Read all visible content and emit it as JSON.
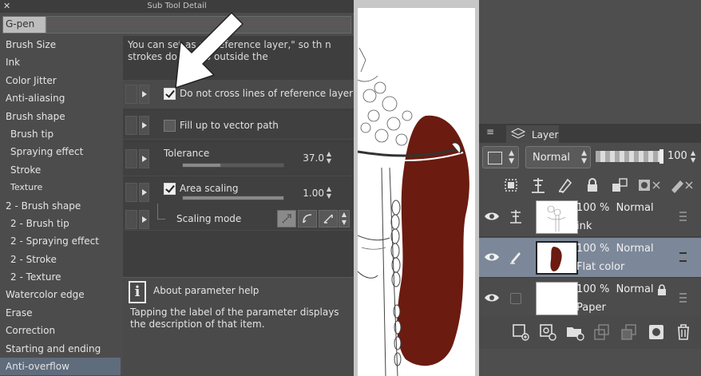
{
  "sub_tool_detail": {
    "close_glyph": "✕",
    "title": "Sub Tool Detail",
    "brush_name": "G-pen",
    "categories": [
      {
        "label": "Brush Size"
      },
      {
        "label": "Ink"
      },
      {
        "label": "Color Jitter"
      },
      {
        "label": "Anti-aliasing"
      },
      {
        "label": "Brush shape"
      },
      {
        "label": "Brush tip"
      },
      {
        "label": "Spraying effect"
      },
      {
        "label": "Stroke"
      },
      {
        "label": "Texture"
      },
      {
        "label": "2 - Brush shape"
      },
      {
        "label": "2 - Brush tip"
      },
      {
        "label": "2 - Spraying effect"
      },
      {
        "label": "2 - Stroke"
      },
      {
        "label": "2 - Texture"
      },
      {
        "label": "Watercolor edge"
      },
      {
        "label": "Erase"
      },
      {
        "label": "Correction"
      },
      {
        "label": "Starting and ending"
      },
      {
        "label": "Anti-overflow"
      }
    ],
    "selected_category": "Anti-overflow",
    "description": "You can set                 as a \"Reference layer,\" so th            n strokes do not go outside the",
    "settings": {
      "do_not_cross": {
        "label": "Do not cross lines of reference layer",
        "checked": true
      },
      "fill_vector": {
        "label": "Fill up to vector path",
        "checked": false
      },
      "tolerance": {
        "label": "Tolerance",
        "value": "37.0",
        "level": 0.37
      },
      "area_scaling": {
        "label": "Area scaling",
        "value": "1.00",
        "checked": true,
        "level": 1.0
      },
      "scaling_mode": {
        "label": "Scaling mode"
      }
    },
    "help": {
      "icon": "i",
      "title": "About parameter help",
      "text": "Tapping the label of the parameter displays the description of that item."
    }
  },
  "layer_panel": {
    "menu_glyph": "≡",
    "tab_label": "Layer",
    "blend_mode": "Normal",
    "opacity": "100",
    "layers": [
      {
        "opacity": "100 %",
        "mode": "Normal",
        "name": "ink",
        "selected": false,
        "visible": true
      },
      {
        "opacity": "100 %",
        "mode": "Normal",
        "name": "Flat color",
        "selected": true,
        "visible": true
      },
      {
        "opacity": "100 %",
        "mode": "Normal",
        "name": "Paper",
        "selected": false,
        "visible": true
      }
    ]
  },
  "colors": {
    "hair": "#6b1b10",
    "selection": "#7c8899"
  }
}
